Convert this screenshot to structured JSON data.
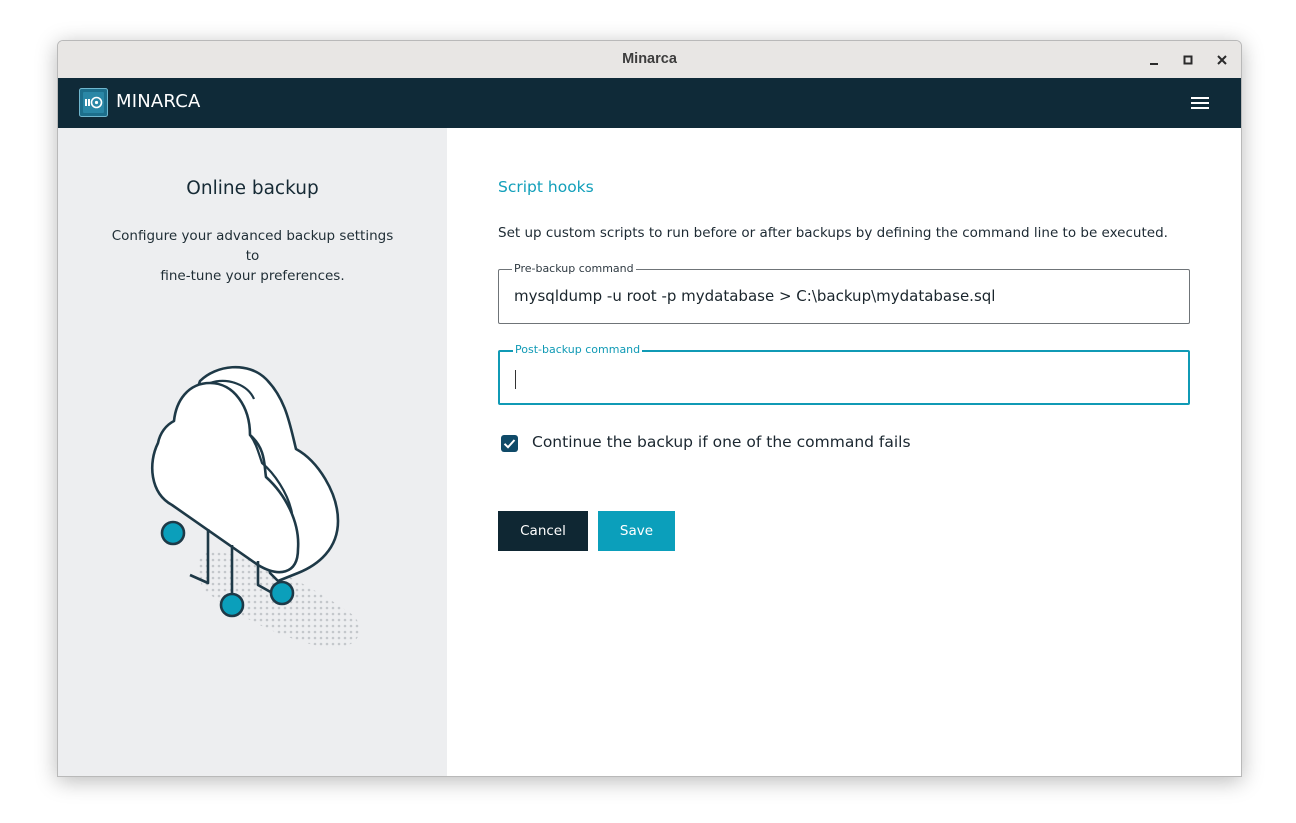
{
  "window": {
    "title": "Minarca",
    "controls": {
      "minimize": "minimize-icon",
      "maximize": "maximize-icon",
      "close": "close-icon"
    }
  },
  "appbar": {
    "brand": "MINARCA",
    "menu_icon": "hamburger-menu-icon",
    "colors": {
      "background": "#0f2a38",
      "accent": "#0b9fbb"
    }
  },
  "left": {
    "title": "Online backup",
    "description_line1": "Configure your advanced backup settings to",
    "description_line2": "fine-tune your preferences.",
    "illustration": "cloud-network-illustration"
  },
  "main": {
    "section_title": "Script hooks",
    "description": "Set up custom scripts to run before or after backups by defining the command line to be executed.",
    "pre_backup": {
      "label": "Pre-backup command",
      "value": "mysqldump -u root -p mydatabase > C:\\backup\\mydatabase.sql"
    },
    "post_backup": {
      "label": "Post-backup command",
      "value": "",
      "focused": true
    },
    "continue_on_failure": {
      "label": "Continue the backup if one of the command fails",
      "checked": true
    },
    "buttons": {
      "cancel": "Cancel",
      "save": "Save"
    }
  }
}
